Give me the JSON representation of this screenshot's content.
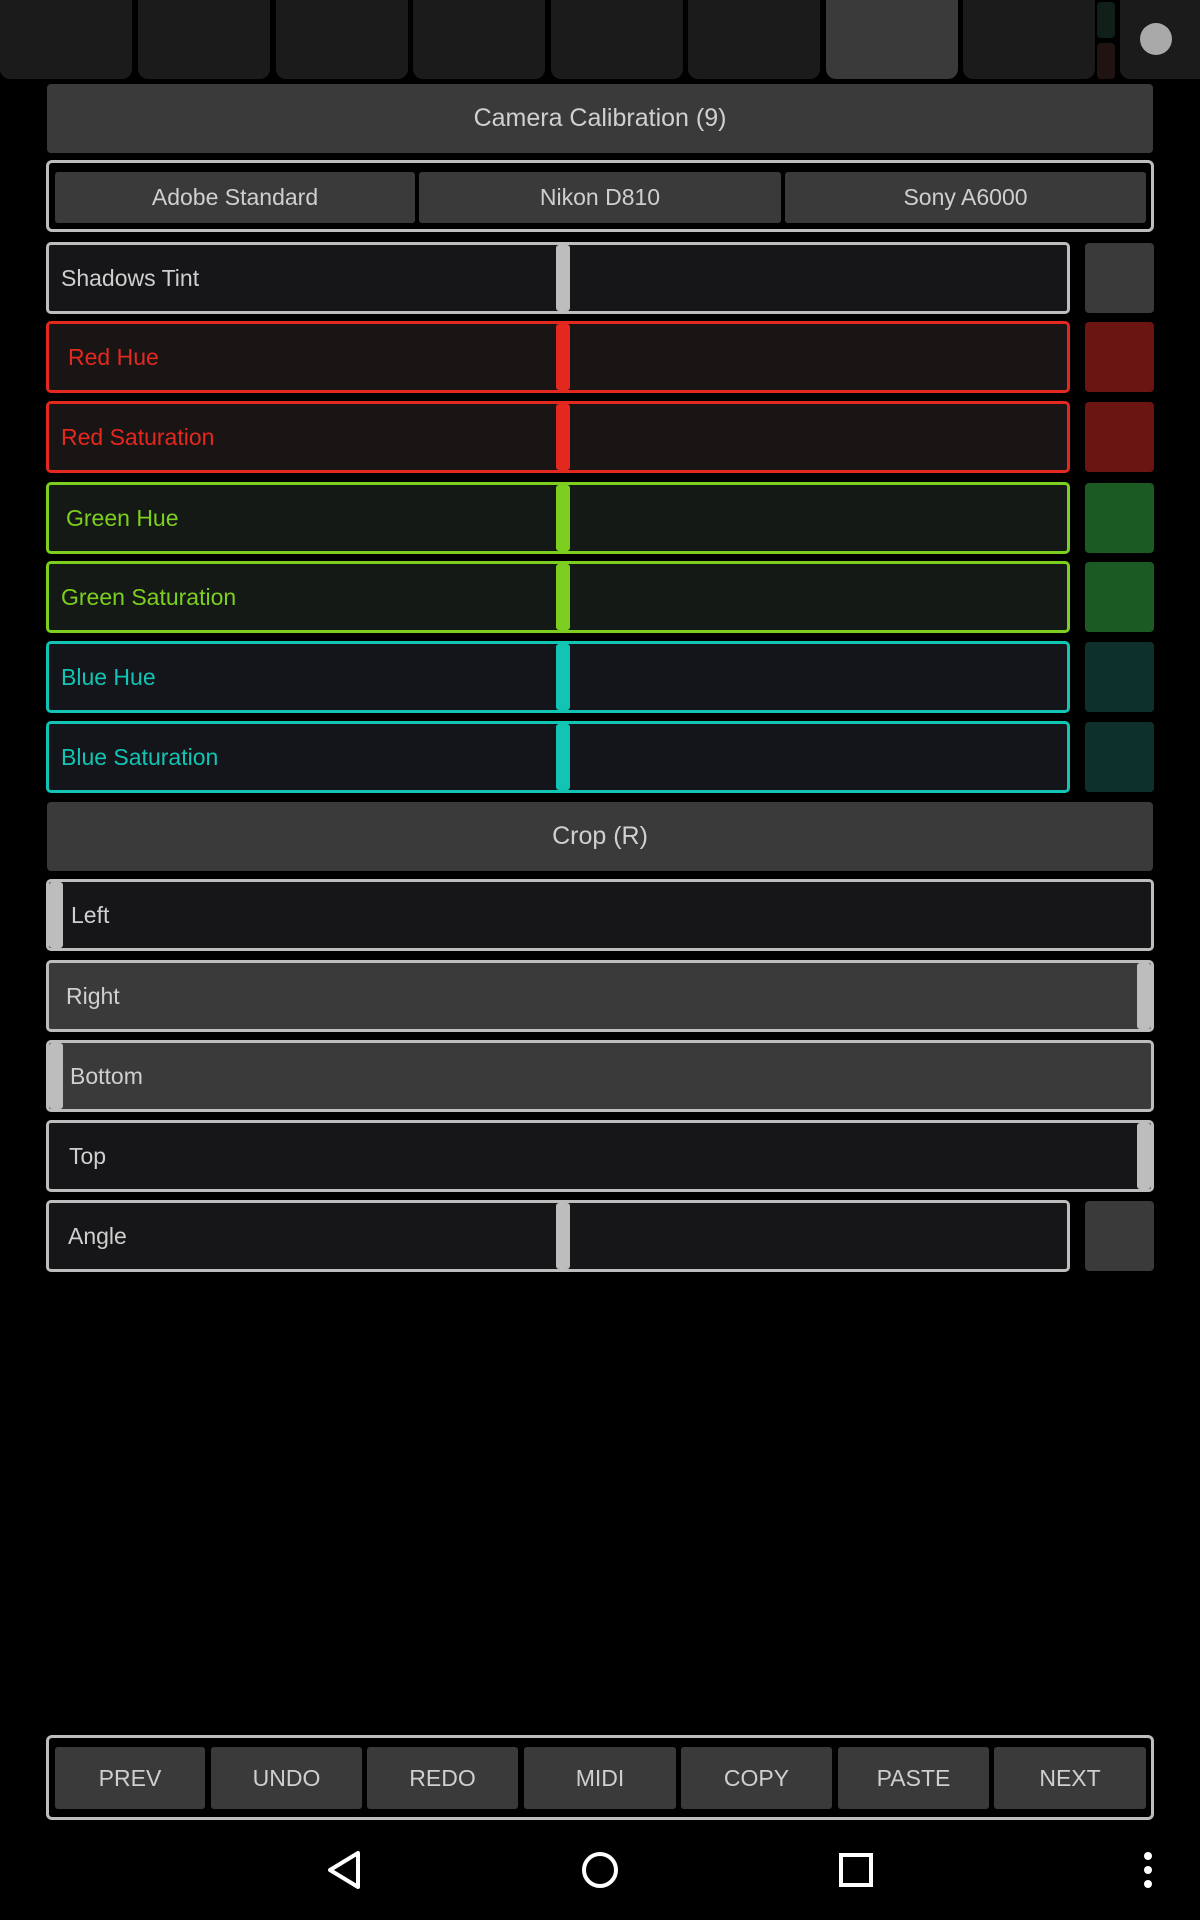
{
  "sections": {
    "calibration_title": "Camera Calibration (9)",
    "crop_title": "Crop (R)"
  },
  "presets": [
    "Adobe Standard",
    "Nikon D810",
    "Sony A6000"
  ],
  "sliders": {
    "shadows_tint": "Shadows Tint",
    "red_hue": "Red Hue",
    "red_saturation": "Red Saturation",
    "green_hue": "Green Hue",
    "green_saturation": "Green Saturation",
    "blue_hue": "Blue Hue",
    "blue_saturation": "Blue Saturation",
    "angle": "Angle"
  },
  "crop": {
    "left": "Left",
    "right": "Right",
    "bottom": "Bottom",
    "top": "Top"
  },
  "toolbar": [
    "PREV",
    "UNDO",
    "REDO",
    "MIDI",
    "COPY",
    "PASTE",
    "NEXT"
  ],
  "colors": {
    "red": "#e3281f",
    "green": "#7ccf1f",
    "blue": "#11c4b3",
    "neutral": "#bdbdbd"
  },
  "icons": {
    "nav_back": "back-triangle-icon",
    "nav_home": "home-circle-icon",
    "nav_recents": "recents-square-icon",
    "overflow": "more-vert-icon"
  }
}
